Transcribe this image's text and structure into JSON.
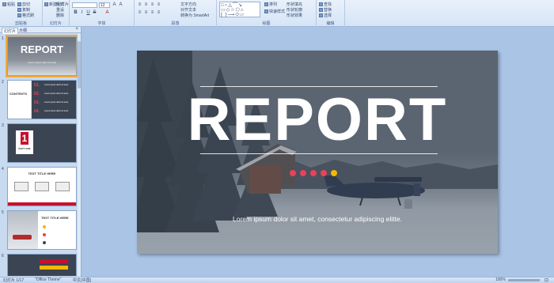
{
  "ribbon": {
    "groups": [
      {
        "label": "剪贴板",
        "buttons": [
          "粘贴",
          "剪切",
          "复制",
          "格式刷"
        ]
      },
      {
        "label": "幻灯片",
        "buttons": [
          "新建幻灯片",
          "版式",
          "重设",
          "删除"
        ]
      },
      {
        "label": "字体",
        "font_size": "12"
      },
      {
        "label": "段落",
        "buttons": [
          "文字方向",
          "对齐文本",
          "转换为 SmartArt"
        ]
      },
      {
        "label": "绘图",
        "buttons": [
          "排列",
          "快速样式",
          "形状填充",
          "形状轮廓",
          "形状效果"
        ]
      },
      {
        "label": "编辑",
        "buttons": [
          "查找",
          "替换",
          "选择"
        ]
      }
    ]
  },
  "pane": {
    "tabs": [
      "幻灯片",
      "大纲"
    ],
    "close": "×"
  },
  "slides": [
    {
      "num": "1",
      "title": "REPORT",
      "caption": "Lorem ipsum dolor sit amet"
    },
    {
      "num": "2",
      "heading": "CONTENTS",
      "items": [
        "01.",
        "02.",
        "03.",
        "04."
      ],
      "lines": [
        "Lorem ipsum dolor sit amet",
        "Lorem ipsum dolor sit amet",
        "Lorem ipsum dolor sit amet",
        "Lorem ipsum dolor sit amet"
      ]
    },
    {
      "num": "3",
      "big": "1",
      "part": "PART ONE"
    },
    {
      "num": "4",
      "heading": "TEXT TITLE HERE"
    },
    {
      "num": "5",
      "heading": "TEXT TITLE HERE"
    },
    {
      "num": "6"
    }
  ],
  "main_slide": {
    "title": "REPORT",
    "subtitle": "Lorem ipsum dolor sit amet, consectetur adipiscing elitte.",
    "dot_colors": [
      "#e8425a",
      "#e8425a",
      "#e8425a",
      "#e8425a",
      "#f5b800"
    ]
  },
  "status": {
    "slide_info": "幻灯片 1/17",
    "theme": "\"Office Theme\"",
    "language": "中文(中国)",
    "zoom": "100%"
  },
  "colors": {
    "accent_red": "#e8425a",
    "accent_yellow": "#f5b800",
    "slide_dark": "#4a5565"
  }
}
